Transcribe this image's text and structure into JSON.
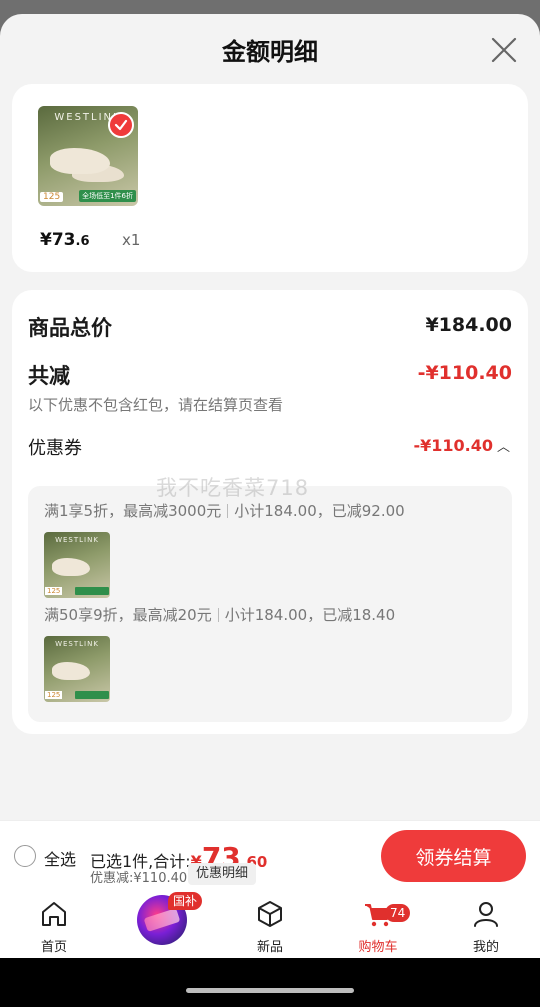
{
  "header": {
    "title": "金额明细"
  },
  "product": {
    "brand": "WESTLINK",
    "thumb_price": "125",
    "thumb_promo": "全场低至1件6折",
    "price_main": "¥73",
    "price_decimal": ".6",
    "quantity": "x1"
  },
  "summary": {
    "total_label": "商品总价",
    "total_value": "¥184.00",
    "reduce_label": "共减",
    "reduce_value": "-¥110.40",
    "reduce_note": "以下优惠不包含红包，请在结算页查看",
    "coupon_label": "优惠券",
    "coupon_value": "-¥110.40"
  },
  "watermark": "我不吃香菜718",
  "coupons": [
    {
      "rule": "满1享5折，最高减3000元",
      "calc": "小计184.00，已减92.00",
      "thumb_brand": "WESTLINK",
      "thumb_price": "125"
    },
    {
      "rule": "满50享9折，最高减20元",
      "calc": "小计184.00，已减18.40",
      "thumb_brand": "WESTLINK",
      "thumb_price": "125"
    }
  ],
  "bottom_bar": {
    "select_all": "全选",
    "selected_prefix": "已选1件,合计:",
    "total_currency": "¥",
    "total_int": "73",
    "total_dec": ".60",
    "discount": "优惠减:¥110.40",
    "detail_link": "优惠明细",
    "checkout": "领券结算"
  },
  "tabs": [
    {
      "label": "首页",
      "icon": "home-icon"
    },
    {
      "label": "",
      "icon": "special-promo-icon",
      "badge": "国补"
    },
    {
      "label": "新品",
      "icon": "cube-icon"
    },
    {
      "label": "购物车",
      "icon": "cart-icon",
      "badge": "74",
      "active": true
    },
    {
      "label": "我的",
      "icon": "person-icon"
    }
  ],
  "colors": {
    "accent": "#e0302d",
    "button": "#ef3b3b",
    "background": "#f3f3f3"
  }
}
